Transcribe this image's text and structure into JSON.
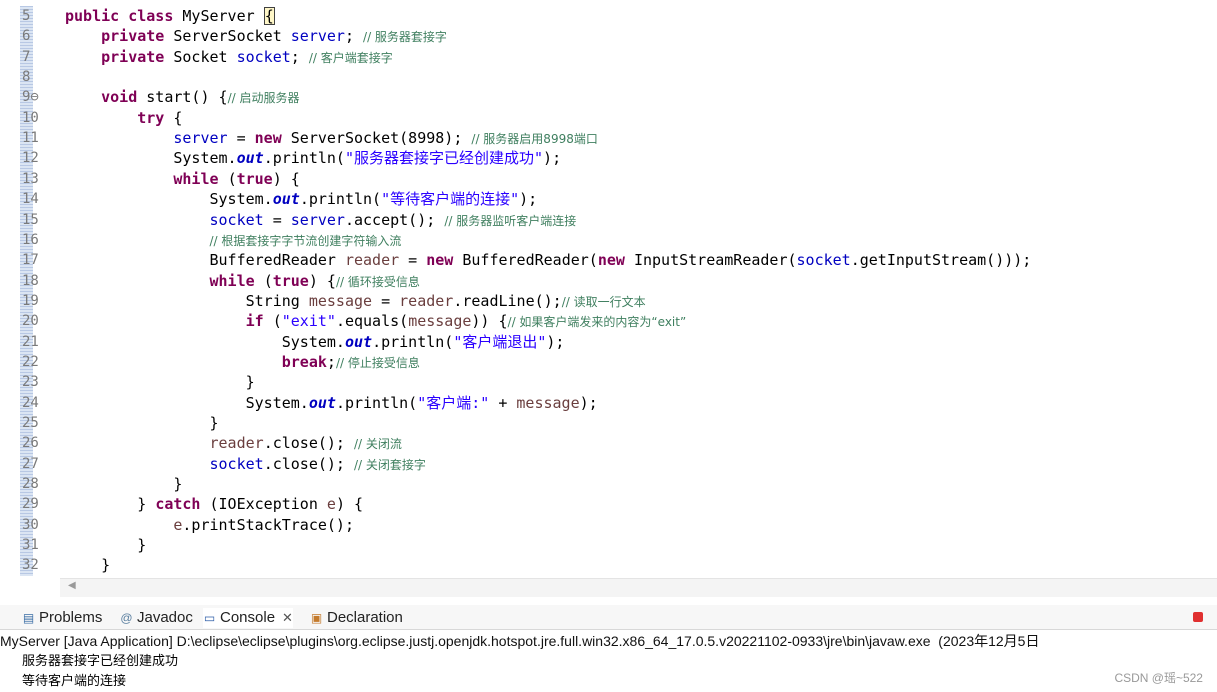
{
  "editor": {
    "lines": [
      {
        "n": "5",
        "tokens": [
          {
            "t": "kw",
            "v": "public "
          },
          {
            "t": "kw",
            "v": "class "
          },
          {
            "t": "p",
            "v": "MyServer "
          },
          {
            "t": "cur",
            "v": "{"
          }
        ]
      },
      {
        "n": "6",
        "tokens": [
          {
            "t": "p",
            "v": "    "
          },
          {
            "t": "kw",
            "v": "private "
          },
          {
            "t": "p",
            "v": "ServerSocket "
          },
          {
            "t": "fld",
            "v": "server"
          },
          {
            "t": "p",
            "v": "; "
          },
          {
            "t": "cm",
            "v": "// 服务器套接字"
          }
        ]
      },
      {
        "n": "7",
        "tokens": [
          {
            "t": "p",
            "v": "    "
          },
          {
            "t": "kw",
            "v": "private "
          },
          {
            "t": "p",
            "v": "Socket "
          },
          {
            "t": "fld",
            "v": "socket"
          },
          {
            "t": "p",
            "v": "; "
          },
          {
            "t": "cm",
            "v": "// 客户端套接字"
          }
        ]
      },
      {
        "n": "8",
        "tokens": []
      },
      {
        "n": "9⊖",
        "tokens": [
          {
            "t": "p",
            "v": "    "
          },
          {
            "t": "kw",
            "v": "void "
          },
          {
            "t": "p",
            "v": "start() {"
          },
          {
            "t": "cm",
            "v": "// 启动服务器"
          }
        ]
      },
      {
        "n": "10",
        "tokens": [
          {
            "t": "p",
            "v": "        "
          },
          {
            "t": "kw",
            "v": "try "
          },
          {
            "t": "p",
            "v": "{"
          }
        ]
      },
      {
        "n": "11",
        "tokens": [
          {
            "t": "p",
            "v": "            "
          },
          {
            "t": "fld",
            "v": "server"
          },
          {
            "t": "p",
            "v": " = "
          },
          {
            "t": "kw",
            "v": "new "
          },
          {
            "t": "p",
            "v": "ServerSocket(8998); "
          },
          {
            "t": "cm",
            "v": "// 服务器启用8998端口"
          }
        ]
      },
      {
        "n": "12",
        "tokens": [
          {
            "t": "p",
            "v": "            System."
          },
          {
            "t": "st",
            "v": "out"
          },
          {
            "t": "p",
            "v": ".println("
          },
          {
            "t": "str",
            "v": "\"服务器套接字已经创建成功\""
          },
          {
            "t": "p",
            "v": ");"
          }
        ]
      },
      {
        "n": "13",
        "tokens": [
          {
            "t": "p",
            "v": "            "
          },
          {
            "t": "kw",
            "v": "while "
          },
          {
            "t": "p",
            "v": "("
          },
          {
            "t": "kw",
            "v": "true"
          },
          {
            "t": "p",
            "v": ") {"
          }
        ]
      },
      {
        "n": "14",
        "tokens": [
          {
            "t": "p",
            "v": "                System."
          },
          {
            "t": "st",
            "v": "out"
          },
          {
            "t": "p",
            "v": ".println("
          },
          {
            "t": "str",
            "v": "\"等待客户端的连接\""
          },
          {
            "t": "p",
            "v": ");"
          }
        ]
      },
      {
        "n": "15",
        "tokens": [
          {
            "t": "p",
            "v": "                "
          },
          {
            "t": "fld",
            "v": "socket"
          },
          {
            "t": "p",
            "v": " = "
          },
          {
            "t": "fld",
            "v": "server"
          },
          {
            "t": "p",
            "v": ".accept(); "
          },
          {
            "t": "cm",
            "v": "// 服务器监听客户端连接"
          }
        ]
      },
      {
        "n": "16",
        "tokens": [
          {
            "t": "p",
            "v": "                "
          },
          {
            "t": "cm",
            "v": "// 根据套接字字节流创建字符输入流"
          }
        ]
      },
      {
        "n": "17",
        "tokens": [
          {
            "t": "p",
            "v": "                BufferedReader "
          },
          {
            "t": "loc",
            "v": "reader"
          },
          {
            "t": "p",
            "v": " = "
          },
          {
            "t": "kw",
            "v": "new "
          },
          {
            "t": "p",
            "v": "BufferedReader("
          },
          {
            "t": "kw",
            "v": "new "
          },
          {
            "t": "p",
            "v": "InputStreamReader("
          },
          {
            "t": "fld",
            "v": "socket"
          },
          {
            "t": "p",
            "v": ".getInputStream()));"
          }
        ]
      },
      {
        "n": "18",
        "tokens": [
          {
            "t": "p",
            "v": "                "
          },
          {
            "t": "kw",
            "v": "while "
          },
          {
            "t": "p",
            "v": "("
          },
          {
            "t": "kw",
            "v": "true"
          },
          {
            "t": "p",
            "v": ") {"
          },
          {
            "t": "cm",
            "v": "// 循环接受信息"
          }
        ]
      },
      {
        "n": "19",
        "tokens": [
          {
            "t": "p",
            "v": "                    String "
          },
          {
            "t": "loc",
            "v": "message"
          },
          {
            "t": "p",
            "v": " = "
          },
          {
            "t": "loc",
            "v": "reader"
          },
          {
            "t": "p",
            "v": ".readLine();"
          },
          {
            "t": "cm",
            "v": "// 读取一行文本"
          }
        ]
      },
      {
        "n": "20",
        "tokens": [
          {
            "t": "p",
            "v": "                    "
          },
          {
            "t": "kw",
            "v": "if "
          },
          {
            "t": "p",
            "v": "("
          },
          {
            "t": "str",
            "v": "\"exit\""
          },
          {
            "t": "p",
            "v": ".equals("
          },
          {
            "t": "loc",
            "v": "message"
          },
          {
            "t": "p",
            "v": ")) {"
          },
          {
            "t": "cm",
            "v": "// 如果客户端发来的内容为“exit”"
          }
        ]
      },
      {
        "n": "21",
        "tokens": [
          {
            "t": "p",
            "v": "                        System."
          },
          {
            "t": "st",
            "v": "out"
          },
          {
            "t": "p",
            "v": ".println("
          },
          {
            "t": "str",
            "v": "\"客户端退出\""
          },
          {
            "t": "p",
            "v": ");"
          }
        ]
      },
      {
        "n": "22",
        "tokens": [
          {
            "t": "p",
            "v": "                        "
          },
          {
            "t": "kw",
            "v": "break"
          },
          {
            "t": "p",
            "v": ";"
          },
          {
            "t": "cm",
            "v": "// 停止接受信息"
          }
        ]
      },
      {
        "n": "23",
        "tokens": [
          {
            "t": "p",
            "v": "                    }"
          }
        ]
      },
      {
        "n": "24",
        "tokens": [
          {
            "t": "p",
            "v": "                    System."
          },
          {
            "t": "st",
            "v": "out"
          },
          {
            "t": "p",
            "v": ".println("
          },
          {
            "t": "str",
            "v": "\"客户端:\""
          },
          {
            "t": "p",
            "v": " + "
          },
          {
            "t": "loc",
            "v": "message"
          },
          {
            "t": "p",
            "v": ");"
          }
        ]
      },
      {
        "n": "25",
        "tokens": [
          {
            "t": "p",
            "v": "                }"
          }
        ]
      },
      {
        "n": "26",
        "tokens": [
          {
            "t": "p",
            "v": "                "
          },
          {
            "t": "loc",
            "v": "reader"
          },
          {
            "t": "p",
            "v": ".close(); "
          },
          {
            "t": "cm",
            "v": "// 关闭流"
          }
        ]
      },
      {
        "n": "27",
        "tokens": [
          {
            "t": "p",
            "v": "                "
          },
          {
            "t": "fld",
            "v": "socket"
          },
          {
            "t": "p",
            "v": ".close(); "
          },
          {
            "t": "cm",
            "v": "// 关闭套接字"
          }
        ]
      },
      {
        "n": "28",
        "tokens": [
          {
            "t": "p",
            "v": "            }"
          }
        ]
      },
      {
        "n": "29",
        "tokens": [
          {
            "t": "p",
            "v": "        } "
          },
          {
            "t": "kw",
            "v": "catch "
          },
          {
            "t": "p",
            "v": "(IOException "
          },
          {
            "t": "loc",
            "v": "e"
          },
          {
            "t": "p",
            "v": ") {"
          }
        ]
      },
      {
        "n": "30",
        "tokens": [
          {
            "t": "p",
            "v": "            "
          },
          {
            "t": "loc",
            "v": "e"
          },
          {
            "t": "p",
            "v": ".printStackTrace();"
          }
        ]
      },
      {
        "n": "31",
        "tokens": [
          {
            "t": "p",
            "v": "        }"
          }
        ]
      },
      {
        "n": "32",
        "tokens": [
          {
            "t": "p",
            "v": "    }"
          }
        ]
      }
    ]
  },
  "views": {
    "tabs": {
      "problems": "Problems",
      "javadoc": "Javadoc",
      "console": "Console",
      "declaration": "Declaration"
    },
    "launch": "MyServer [Java Application] D:\\eclipse\\eclipse\\plugins\\org.eclipse.justj.openjdk.hotspot.jre.full.win32.x86_64_17.0.5.v20221102-0933\\jre\\bin\\javaw.exe  (2023年12月5日",
    "output": [
      "服务器套接字已经创建成功",
      "等待客户端的连接"
    ],
    "watermark": "CSDN @瑶~522"
  },
  "icons": {
    "problems": "problems-icon",
    "javadoc": "at-icon",
    "console": "console-icon",
    "declaration": "declaration-icon",
    "stop": "terminate-icon",
    "close": "close-icon"
  },
  "colors": {
    "keyword": "#7f0055",
    "field": "#0000c0",
    "string": "#2a00ff",
    "comment": "#3f7f5f",
    "local": "#6a3e3e",
    "terminate": "#e03030"
  }
}
